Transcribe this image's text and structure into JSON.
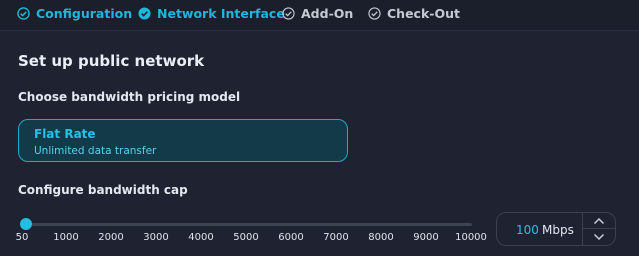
{
  "steps": [
    {
      "label": "Configuration",
      "state": "active",
      "icon": "check-circle-filled"
    },
    {
      "label": "Network Interface",
      "state": "active",
      "icon": "check-circle-filled"
    },
    {
      "label": "Add-On",
      "state": "inactive",
      "icon": "check-circle-outline"
    },
    {
      "label": "Check-Out",
      "state": "inactive",
      "icon": "check-circle-outline"
    }
  ],
  "page_title": "Set up public network",
  "pricing": {
    "label": "Choose bandwidth pricing model",
    "card_title": "Flat Rate",
    "card_subtitle": "Unlimited data transfer"
  },
  "bandwidth": {
    "label": "Configure bandwidth cap",
    "min": 50,
    "max": 10000,
    "value": 100,
    "value_text": "100",
    "unit": "Mbps",
    "ticks": [
      "50",
      "1000",
      "2000",
      "3000",
      "4000",
      "5000",
      "6000",
      "7000",
      "8000",
      "9000",
      "10000"
    ]
  },
  "colors": {
    "accent": "#1fb6d9",
    "background": "#1f2331"
  }
}
